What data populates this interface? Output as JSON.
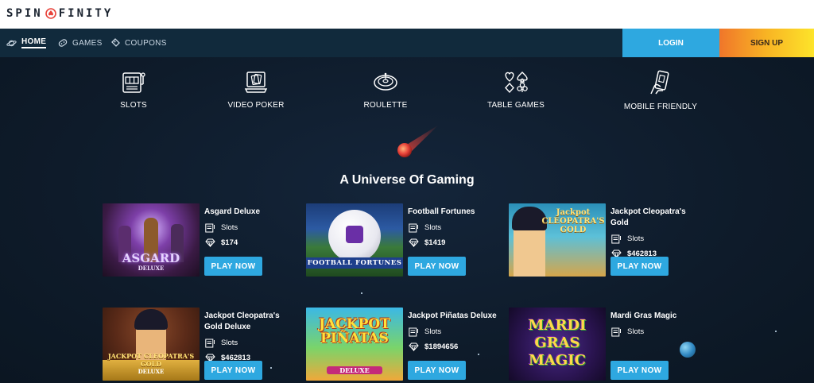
{
  "brand": {
    "logo_left": "SPIN",
    "logo_right": "FINITY"
  },
  "nav": {
    "items": [
      {
        "label": "HOME",
        "icon": "planet-icon",
        "active": true
      },
      {
        "label": "GAMES",
        "icon": "gamepad-icon",
        "active": false
      },
      {
        "label": "COUPONS",
        "icon": "ticket-icon",
        "active": false
      }
    ],
    "login": "LOGIN",
    "signup": "SIGN UP"
  },
  "categories": [
    {
      "label": "SLOTS",
      "icon": "slot-machine-icon"
    },
    {
      "label": "VIDEO POKER",
      "icon": "video-poker-icon"
    },
    {
      "label": "ROULETTE",
      "icon": "roulette-icon"
    },
    {
      "label": "TABLE GAMES",
      "icon": "card-suits-icon"
    },
    {
      "label": "MOBILE FRIENDLY",
      "icon": "mobile-hand-icon"
    }
  ],
  "heading": "A Universe Of Gaming",
  "games": [
    {
      "name": "Asgard Deluxe",
      "type": "Slots",
      "jackpot": "$174",
      "thumb_title": "ASGARD",
      "thumb_sub": "DELUXE"
    },
    {
      "name": "Football Fortunes",
      "type": "Slots",
      "jackpot": "$1419",
      "thumb_title": "FOOTBALL FORTUNES",
      "thumb_sub": ""
    },
    {
      "name": "Jackpot Cleopatra's Gold",
      "type": "Slots",
      "jackpot": "$462813",
      "thumb_title": "Jackpot CLEOPATRA'S GOLD",
      "thumb_sub": ""
    },
    {
      "name": "Jackpot Cleopatra's Gold Deluxe",
      "type": "Slots",
      "jackpot": "$462813",
      "thumb_title": "JACKPOT CLEOPATRA'S GOLD",
      "thumb_sub": "DELUXE"
    },
    {
      "name": "Jackpot Piñatas Deluxe",
      "type": "Slots",
      "jackpot": "$1894656",
      "thumb_title": "JACKPOT PIÑATAS",
      "thumb_sub": "DELUXE"
    },
    {
      "name": "Mardi Gras Magic",
      "type": "Slots",
      "jackpot": "",
      "thumb_title": "MARDI GRAS MAGIC",
      "thumb_sub": ""
    }
  ],
  "play_label": "PLAY NOW",
  "colors": {
    "accent": "#2ea8e0",
    "nav_bg": "#112a3c",
    "page_bg": "#0e1a27"
  }
}
